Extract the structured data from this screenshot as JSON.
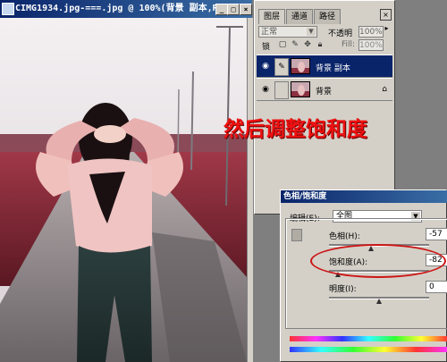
{
  "document": {
    "title": "CIMG1934.jpg-===.jpg @ 100%(背景 副本,RGB)",
    "buttons": {
      "minimize": "_",
      "maximize": "□",
      "close": "×"
    }
  },
  "annotation": {
    "text": "然后调整饱和度",
    "color": "#ee1111"
  },
  "layers_panel": {
    "tabs": [
      "图层",
      "通道",
      "路径"
    ],
    "blend_mode": "正常",
    "opacity_label": "不透明",
    "opacity_value": "100%",
    "lock_label": "锁",
    "fill_label": "Fill:",
    "fill_value": "100%",
    "layers": [
      {
        "name": "背景 副本",
        "selected": true
      },
      {
        "name": "背景",
        "selected": false
      }
    ],
    "icons": [
      "eye-icon",
      "brush-icon",
      "lock-icon"
    ]
  },
  "hue_saturation": {
    "title": "色相/饱和度",
    "edit_label": "编辑(E):",
    "edit_value": "全图",
    "sliders": [
      {
        "label": "色相(H):",
        "value": "-57",
        "fraction": 0.42
      },
      {
        "label": "饱和度(A):",
        "value": "-82",
        "fraction": 0.09
      },
      {
        "label": "明度(I):",
        "value": "0",
        "fraction": 0.5
      }
    ]
  },
  "colors": {
    "titlebar": "#0a246a",
    "panel": "#d4d0c8",
    "highlight": "#cc1515"
  }
}
